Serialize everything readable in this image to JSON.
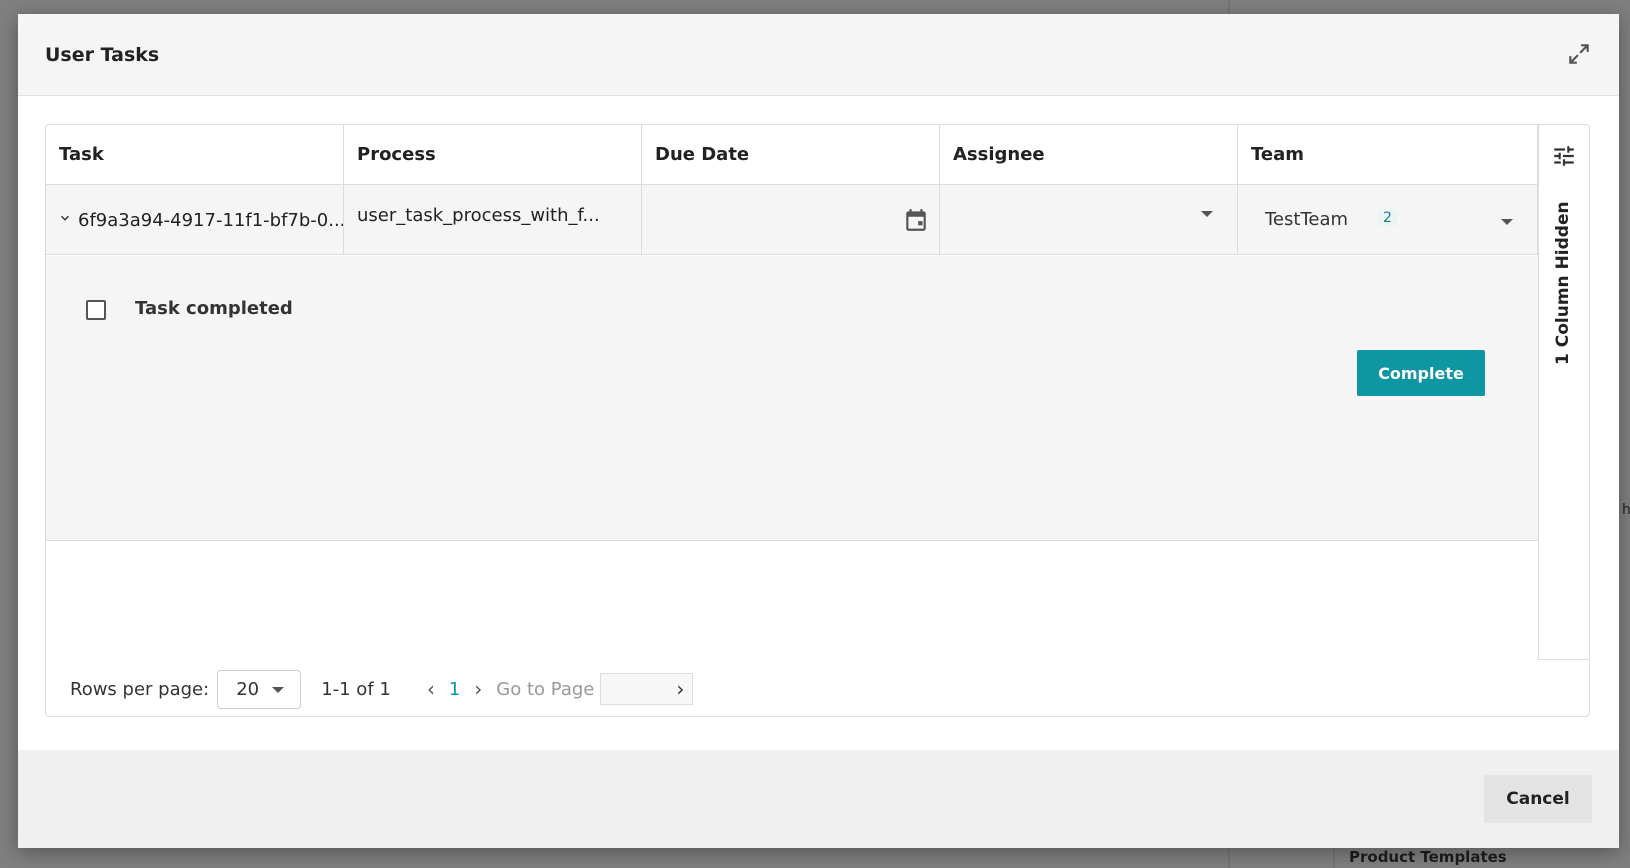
{
  "modal": {
    "title": "User Tasks"
  },
  "table": {
    "columns": [
      "Task",
      "Process",
      "Due Date",
      "Assignee",
      "Team"
    ],
    "row": {
      "task": "6f9a3a94-4917-11f1-bf7b-0...",
      "process": "user_task_process_with_f...",
      "due_date": "",
      "assignee": "",
      "team": "TestTeam",
      "team_count": "2"
    },
    "expanded": {
      "checkbox_label": "Task completed",
      "complete_button": "Complete"
    },
    "hidden_columns_label": "1 Column Hidden"
  },
  "pagination": {
    "rows_per_page_label": "Rows per page:",
    "rows_per_page_value": "20",
    "range": "1-1 of 1",
    "current_page": "1",
    "go_to_page_label": "Go to Page"
  },
  "footer": {
    "cancel_button": "Cancel"
  },
  "background": {
    "text": "Product Templates"
  }
}
